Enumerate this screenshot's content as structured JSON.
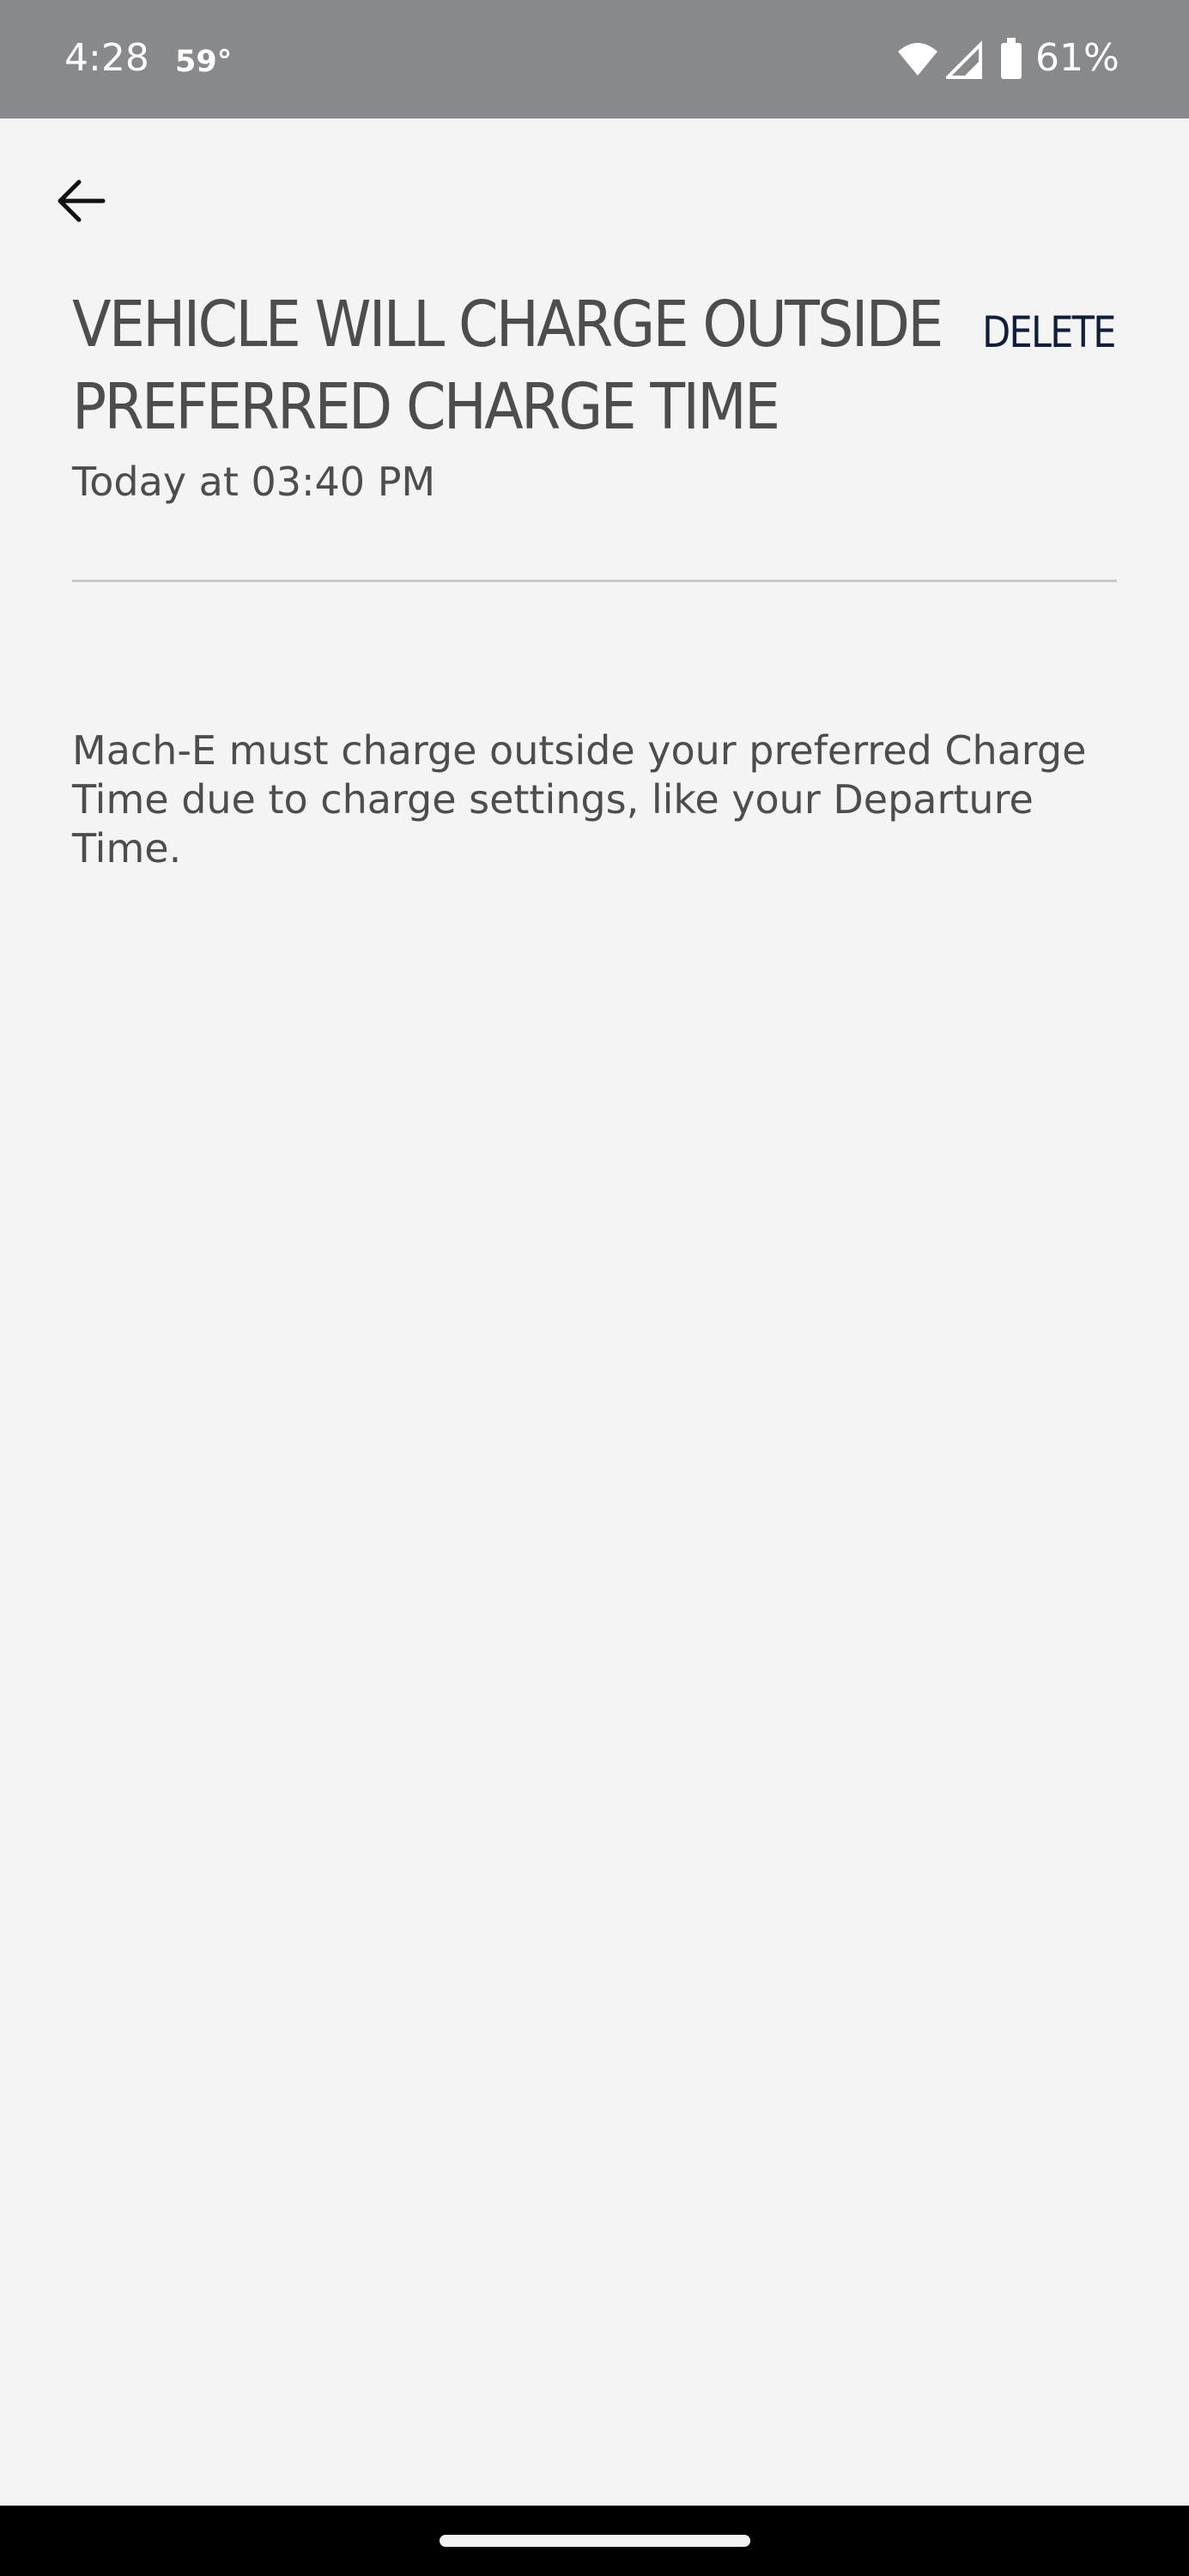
{
  "status_bar": {
    "time": "4:28",
    "temperature": "59°",
    "battery_percent": "61%",
    "icons": [
      "wifi-icon",
      "signal-icon",
      "battery-icon"
    ]
  },
  "header": {
    "back_icon": "arrow-left-icon",
    "delete_label": "DELETE"
  },
  "notification": {
    "title_line1": "VEHICLE WILL CHARGE OUTSIDE",
    "title_line2": "PREFERRED CHARGE TIME",
    "timestamp": "Today at 03:40 PM",
    "message": "Mach-E must charge outside your preferred Charge Time due to charge settings, like your Departure Time."
  },
  "colors": {
    "status_bar_bg": "#88898d",
    "page_bg": "#f4f4f4",
    "text": "#4d4d4f",
    "delete_accent": "#0f1e3c"
  }
}
